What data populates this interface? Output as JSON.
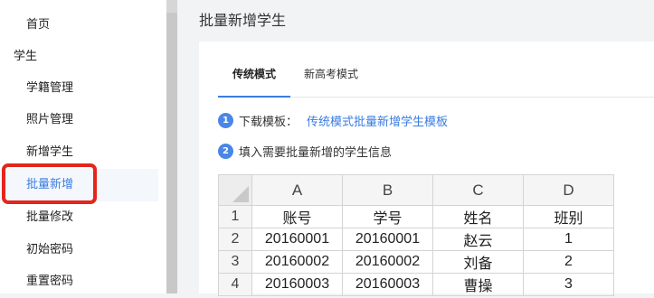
{
  "sidebar": {
    "items": [
      {
        "label": "首页",
        "type": "item"
      },
      {
        "label": "学生",
        "type": "group"
      },
      {
        "label": "学籍管理",
        "type": "item"
      },
      {
        "label": "照片管理",
        "type": "item"
      },
      {
        "label": "新增学生",
        "type": "item"
      },
      {
        "label": "批量新增",
        "type": "item",
        "active": true
      },
      {
        "label": "批量修改",
        "type": "item"
      },
      {
        "label": "初始密码",
        "type": "item"
      },
      {
        "label": "重置密码",
        "type": "item"
      }
    ]
  },
  "main": {
    "title": "批量新增学生",
    "tabs": [
      {
        "label": "传统模式",
        "active": true
      },
      {
        "label": "新高考模式",
        "active": false
      }
    ],
    "steps": [
      {
        "number": "1",
        "text": "下载模板：",
        "link": "传统模式批量新增学生模板"
      },
      {
        "number": "2",
        "text": "填入需要批量新增的学生信息"
      }
    ],
    "spreadsheet": {
      "columns": [
        "A",
        "B",
        "C",
        "D"
      ],
      "rows": [
        {
          "num": "1",
          "cells": [
            "账号",
            "学号",
            "姓名",
            "班别"
          ]
        },
        {
          "num": "2",
          "cells": [
            "20160001",
            "20160001",
            "赵云",
            "1"
          ]
        },
        {
          "num": "3",
          "cells": [
            "20160002",
            "20160002",
            "刘备",
            "2"
          ]
        },
        {
          "num": "4",
          "cells": [
            "20160003",
            "20160003",
            "曹操",
            "3"
          ]
        }
      ]
    }
  },
  "colors": {
    "accent": "#3a7ce0",
    "highlight_border": "#e4251c",
    "badge": "#4a86e8"
  }
}
